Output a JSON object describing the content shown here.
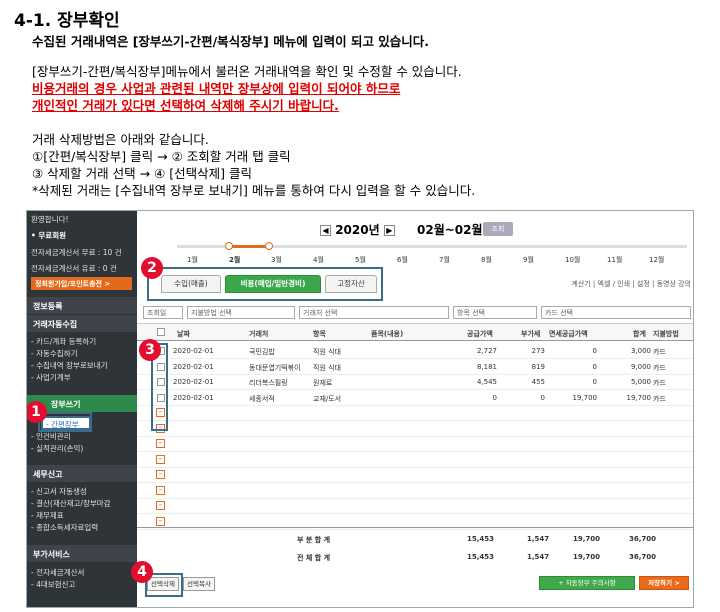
{
  "doc": {
    "title": "4-1. 장부확인",
    "subtitle": "수집된 거래내역은 [장부쓰기-간편/복식장부] 메뉴에 입력이 되고 있습니다.",
    "line1": "[장부쓰기-간편/복식장부]메뉴에서 불러온 거래내역을 확인 및 수정할 수 있습니다.",
    "red1": "비용거래의 경우 사업과 관련된 내역만 장부상에 입력이 되어야 하므로",
    "red2": "개인적인 거래가 있다면 선택하여 삭제해 주시기 바랍니다.",
    "line2": "거래 삭제방법은 아래와 같습니다.",
    "line3": "①[간편/복식장부] 클릭 → ② 조회할 거래 탭 클릭",
    "line4": "③ 삭제할 거래 선택 → ④ [선택삭제]  클릭",
    "line5": " *삭제된 거래는 [수집내역 장부로 보내기] 메뉴를 통하여 다시 입력을 할 수 있습니다."
  },
  "sidebar": {
    "welcome": "환영합니다!",
    "free_member": "• 무료회원",
    "free_invoice": "전자세금계산서 무료 : 10 건",
    "paid_invoice": "전자세금계산서 유료 : 0 건",
    "join_button": "정회원가입/포인트충전 >",
    "info_reg": "정보등록",
    "auto_collect": "거래자동수집",
    "collect_items": [
      "- 카드/계좌 등록하기",
      "- 자동수집하기",
      "- 수집내역 장부로보내기",
      "- 사업기계부"
    ],
    "book_write": "장부쓰기",
    "book_items": [
      "- 간편장부",
      "- 인건비관리",
      "- 실적관리(손익)"
    ],
    "tax_report": "세무신고",
    "tax_items": [
      "- 신고서 자동생성",
      "- 결산(재산재고/장부마감",
      "- 재무제표",
      "- 종합소득세자료입력"
    ],
    "extra": "부가서비스",
    "extra_items": [
      "- 전자세금계산서",
      "- 4대보험신고"
    ]
  },
  "header": {
    "year": "2020년",
    "period": "02월~02월",
    "query_button": "조회",
    "months": [
      "1월",
      "2월",
      "3월",
      "4월",
      "5월",
      "6월",
      "7월",
      "8월",
      "9월",
      "10월",
      "11월",
      "12월"
    ]
  },
  "tabs": [
    "수입(매출)",
    "비용(매입/일반경비)",
    "고정자산"
  ],
  "tools": "계산기 | 엑셀 / 인쇄 | 설정 | 동영상 강의",
  "filters": [
    "조회일",
    "지불방법 선택",
    "거래처 선택",
    "항목 선택",
    "카드 선택"
  ],
  "table": {
    "headers": [
      "날짜",
      "거래처",
      "항목",
      "품목(내용)",
      "공급가액",
      "부가세",
      "면세공급가액",
      "합계",
      "지불방법"
    ],
    "rows": [
      [
        "2020-02-01",
        "국민김밥",
        "직원 식대",
        "",
        "2,727",
        "273",
        "0",
        "3,000",
        "카드"
      ],
      [
        "2020-02-01",
        "동대문엽기떡볶이",
        "직원 식대",
        "",
        "8,181",
        "819",
        "0",
        "9,000",
        "카드"
      ],
      [
        "2020-02-01",
        "리더복스필링",
        "원재료",
        "",
        "4,545",
        "455",
        "0",
        "5,000",
        "카드"
      ],
      [
        "2020-02-01",
        "세종서적",
        "교재/도서",
        "",
        "0",
        "0",
        "19,700",
        "19,700",
        "카드"
      ]
    ],
    "subtotal_label": "부 분 합 계",
    "total_label": "전 체 합 계",
    "subtotal": [
      "15,453",
      "1,547",
      "19,700",
      "36,700"
    ],
    "total": [
      "15,453",
      "1,547",
      "19,700",
      "36,700"
    ]
  },
  "buttons": {
    "select_delete": "선택삭제",
    "select_print": "선택복사",
    "auto_book": "+ 자동장부 주의사항",
    "save": "저장하기 >"
  },
  "badges": [
    "1",
    "2",
    "3",
    "4"
  ]
}
